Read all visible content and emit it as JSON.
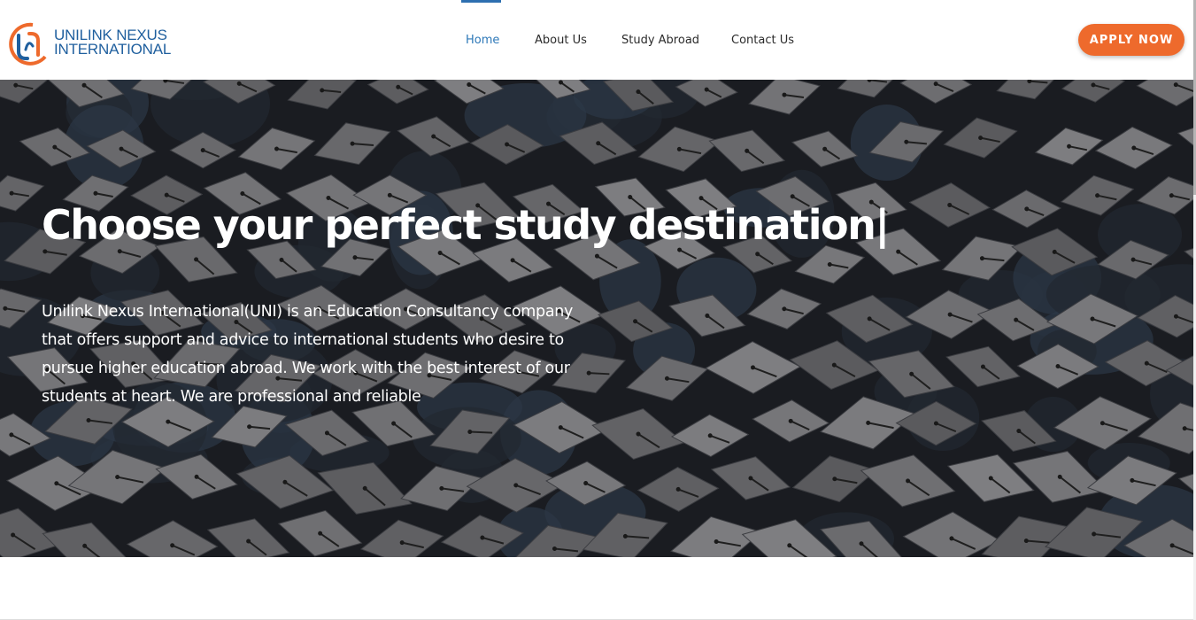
{
  "brand": {
    "name_line1": "UNILINK NEXUS",
    "name_line2": "INTERNATIONAL",
    "colors": {
      "blue": "#1f5f9e",
      "orange": "#ee6a2c"
    },
    "mark_icon": "unilink-logo-mark"
  },
  "nav": {
    "items": [
      {
        "label": "Home",
        "active": true
      },
      {
        "label": "About Us",
        "active": false
      },
      {
        "label": "Study Abroad",
        "active": false
      },
      {
        "label": "Contact Us",
        "active": false
      }
    ],
    "active_color": "#2d78b8"
  },
  "cta": {
    "label": "APPLY NOW",
    "color": "#ee6a2c"
  },
  "hero": {
    "title": "Choose your perfect study destination|",
    "description": "Unilink Nexus International(UNI) is an Education Consultancy company that offers support and advice to international students who desire to pursue higher education abroad. We work with the best interest of our students at heart. We are professional and reliable",
    "background": "graduation-caps-photo"
  }
}
